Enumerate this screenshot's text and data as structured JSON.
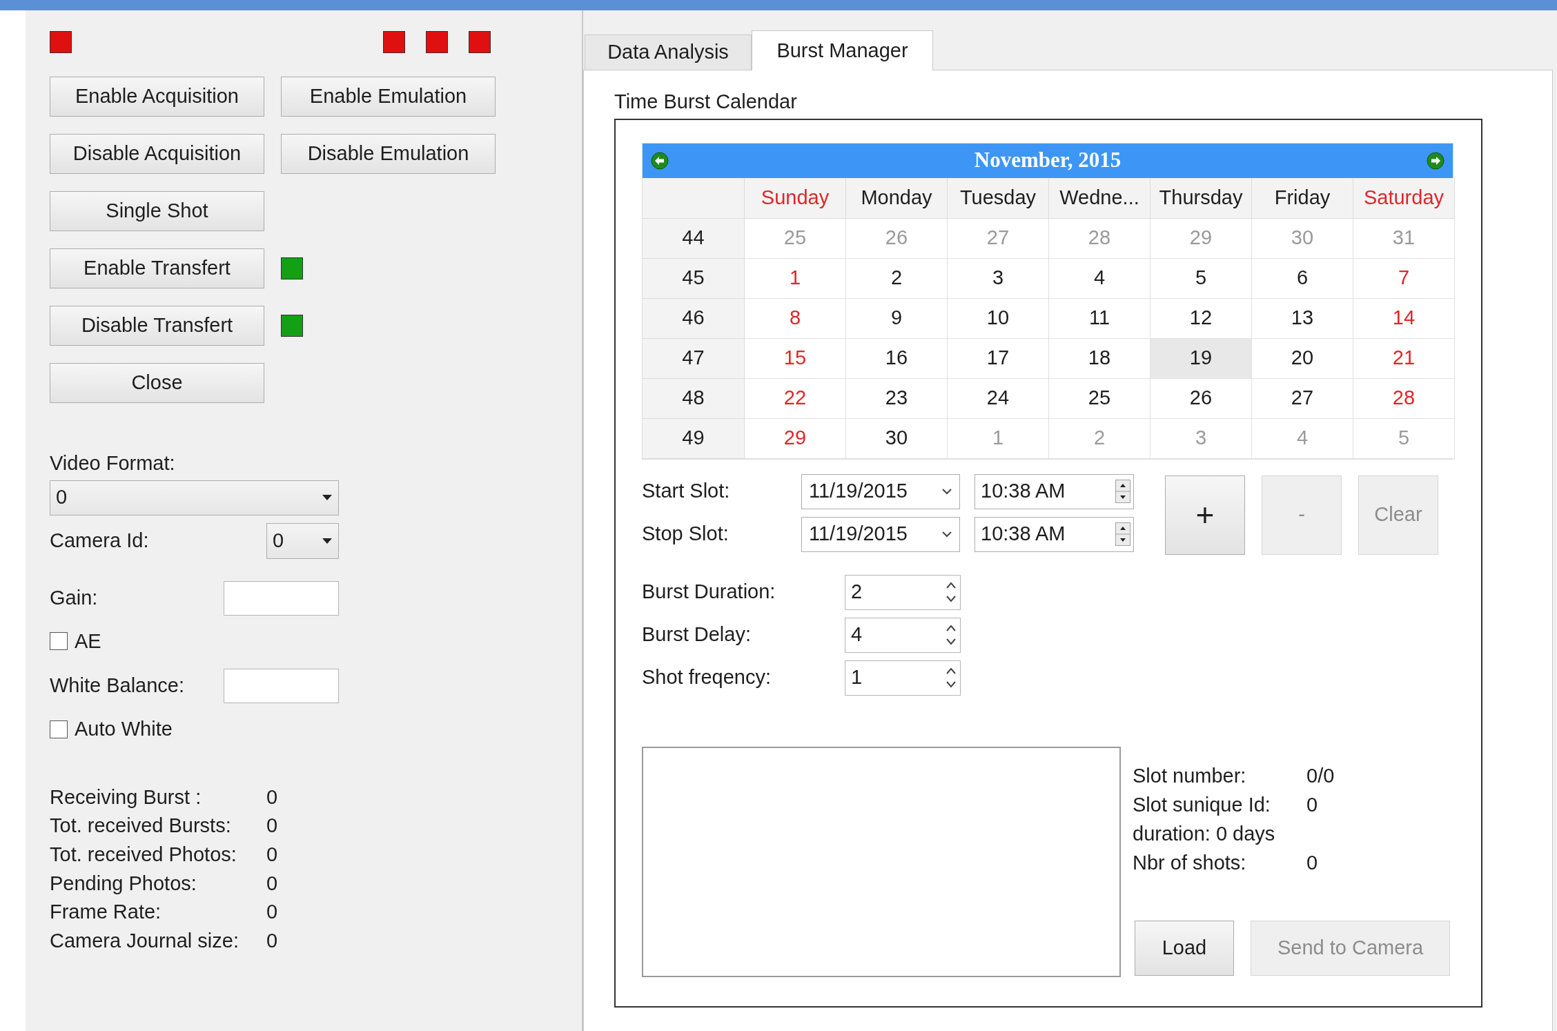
{
  "control_panel": {
    "status_lights": [
      {
        "color": "#e01010"
      },
      {
        "color": "#e01010"
      },
      {
        "color": "#e01010"
      },
      {
        "color": "#e01010"
      }
    ],
    "button_rows": [
      {
        "buttons": [
          {
            "label": "Enable Acquisition"
          },
          {
            "label": "Enable Emulation"
          }
        ]
      },
      {
        "buttons": [
          {
            "label": "Disable Acquisition"
          },
          {
            "label": "Disable Emulation"
          }
        ]
      },
      {
        "buttons": [
          {
            "label": "Single Shot"
          }
        ]
      },
      {
        "buttons": [
          {
            "label": "Enable Transfert"
          }
        ],
        "light": {
          "color": "#14a014"
        }
      },
      {
        "buttons": [
          {
            "label": "Disable Transfert"
          }
        ],
        "light": {
          "color": "#14a014"
        }
      },
      {
        "buttons": [
          {
            "label": "Close"
          }
        ]
      }
    ],
    "video_format": {
      "label": "Video Format:",
      "value": "0"
    },
    "camera_id": {
      "label": "Camera Id:",
      "value": "0"
    },
    "gain": {
      "label": "Gain:"
    },
    "ae": {
      "label": "AE",
      "checked": false
    },
    "white_balance": {
      "label": "White Balance:"
    },
    "auto_white": {
      "label": "Auto White",
      "checked": false
    },
    "stats": [
      {
        "label": "Receiving Burst :",
        "value": "0"
      },
      {
        "label": "Tot. received Bursts:",
        "value": "0"
      },
      {
        "label": "Tot. received Photos:",
        "value": "0"
      },
      {
        "label": "Pending Photos:",
        "value": "0"
      },
      {
        "label": "Frame Rate:",
        "value": "0"
      },
      {
        "label": "Camera Journal size:",
        "value": "0"
      }
    ]
  },
  "tabs": [
    {
      "label": "Data Analysis",
      "selected": false
    },
    {
      "label": "Burst Manager",
      "selected": true
    }
  ],
  "burst_calendar": {
    "title": "Time Burst Calendar",
    "calendar": {
      "month": "November, 2015",
      "weekdays": [
        {
          "label": "Sunday",
          "kind": "weekend"
        },
        {
          "label": "Monday",
          "kind": "weekday"
        },
        {
          "label": "Tuesday",
          "kind": "weekday"
        },
        {
          "label": "Wedne...",
          "kind": "weekday"
        },
        {
          "label": "Thursday",
          "kind": "weekday"
        },
        {
          "label": "Friday",
          "kind": "weekday"
        },
        {
          "label": "Saturday",
          "kind": "weekend"
        }
      ],
      "weeks": [
        {
          "number": "44",
          "days": [
            {
              "day": "25",
              "kind": "other",
              "selected": false
            },
            {
              "day": "26",
              "kind": "other",
              "selected": false
            },
            {
              "day": "27",
              "kind": "other",
              "selected": false
            },
            {
              "day": "28",
              "kind": "other",
              "selected": false
            },
            {
              "day": "29",
              "kind": "other",
              "selected": false
            },
            {
              "day": "30",
              "kind": "other",
              "selected": false
            },
            {
              "day": "31",
              "kind": "other",
              "selected": false
            }
          ]
        },
        {
          "number": "45",
          "days": [
            {
              "day": "1",
              "kind": "weekend",
              "selected": false
            },
            {
              "day": "2",
              "kind": "weekday",
              "selected": false
            },
            {
              "day": "3",
              "kind": "weekday",
              "selected": false
            },
            {
              "day": "4",
              "kind": "weekday",
              "selected": false
            },
            {
              "day": "5",
              "kind": "weekday",
              "selected": false
            },
            {
              "day": "6",
              "kind": "weekday",
              "selected": false
            },
            {
              "day": "7",
              "kind": "weekend",
              "selected": false
            }
          ]
        },
        {
          "number": "46",
          "days": [
            {
              "day": "8",
              "kind": "weekend",
              "selected": false
            },
            {
              "day": "9",
              "kind": "weekday",
              "selected": false
            },
            {
              "day": "10",
              "kind": "weekday",
              "selected": false
            },
            {
              "day": "11",
              "kind": "weekday",
              "selected": false
            },
            {
              "day": "12",
              "kind": "weekday",
              "selected": false
            },
            {
              "day": "13",
              "kind": "weekday",
              "selected": false
            },
            {
              "day": "14",
              "kind": "weekend",
              "selected": false
            }
          ]
        },
        {
          "number": "47",
          "days": [
            {
              "day": "15",
              "kind": "weekend",
              "selected": false
            },
            {
              "day": "16",
              "kind": "weekday",
              "selected": false
            },
            {
              "day": "17",
              "kind": "weekday",
              "selected": false
            },
            {
              "day": "18",
              "kind": "weekday",
              "selected": false
            },
            {
              "day": "19",
              "kind": "weekday",
              "selected": true
            },
            {
              "day": "20",
              "kind": "weekday",
              "selected": false
            },
            {
              "day": "21",
              "kind": "weekend",
              "selected": false
            }
          ]
        },
        {
          "number": "48",
          "days": [
            {
              "day": "22",
              "kind": "weekend",
              "selected": false
            },
            {
              "day": "23",
              "kind": "weekday",
              "selected": false
            },
            {
              "day": "24",
              "kind": "weekday",
              "selected": false
            },
            {
              "day": "25",
              "kind": "weekday",
              "selected": false
            },
            {
              "day": "26",
              "kind": "weekday",
              "selected": false
            },
            {
              "day": "27",
              "kind": "weekday",
              "selected": false
            },
            {
              "day": "28",
              "kind": "weekend",
              "selected": false
            }
          ]
        },
        {
          "number": "49",
          "days": [
            {
              "day": "29",
              "kind": "weekend",
              "selected": false
            },
            {
              "day": "30",
              "kind": "weekday",
              "selected": false
            },
            {
              "day": "1",
              "kind": "other",
              "selected": false
            },
            {
              "day": "2",
              "kind": "other",
              "selected": false
            },
            {
              "day": "3",
              "kind": "other",
              "selected": false
            },
            {
              "day": "4",
              "kind": "other",
              "selected": false
            },
            {
              "day": "5",
              "kind": "other",
              "selected": false
            }
          ]
        }
      ]
    },
    "slots": [
      {
        "label": "Start Slot:",
        "date": "11/19/2015",
        "time": "10:38 AM"
      },
      {
        "label": "Stop Slot:",
        "date": "11/19/2015",
        "time": "10:38 AM"
      }
    ],
    "slot_buttons": [
      {
        "label": "+",
        "disabled": false
      },
      {
        "label": "-",
        "disabled": true
      },
      {
        "label": "Clear",
        "disabled": true
      }
    ],
    "burst_settings": [
      {
        "label": "Burst Duration:",
        "value": "2"
      },
      {
        "label": "Burst Delay:",
        "value": "4"
      },
      {
        "label": "Shot freqency:",
        "value": "1"
      }
    ],
    "slot_info": [
      {
        "label": "Slot number:",
        "value": "0/0"
      },
      {
        "label": "Slot sunique Id:",
        "value": "0"
      },
      {
        "label": "duration: 0 days"
      },
      {
        "label": "Nbr of shots:",
        "value": "0"
      }
    ],
    "actions": [
      {
        "label": "Load",
        "disabled": false
      },
      {
        "label": "Send to Camera",
        "disabled": true
      }
    ]
  }
}
